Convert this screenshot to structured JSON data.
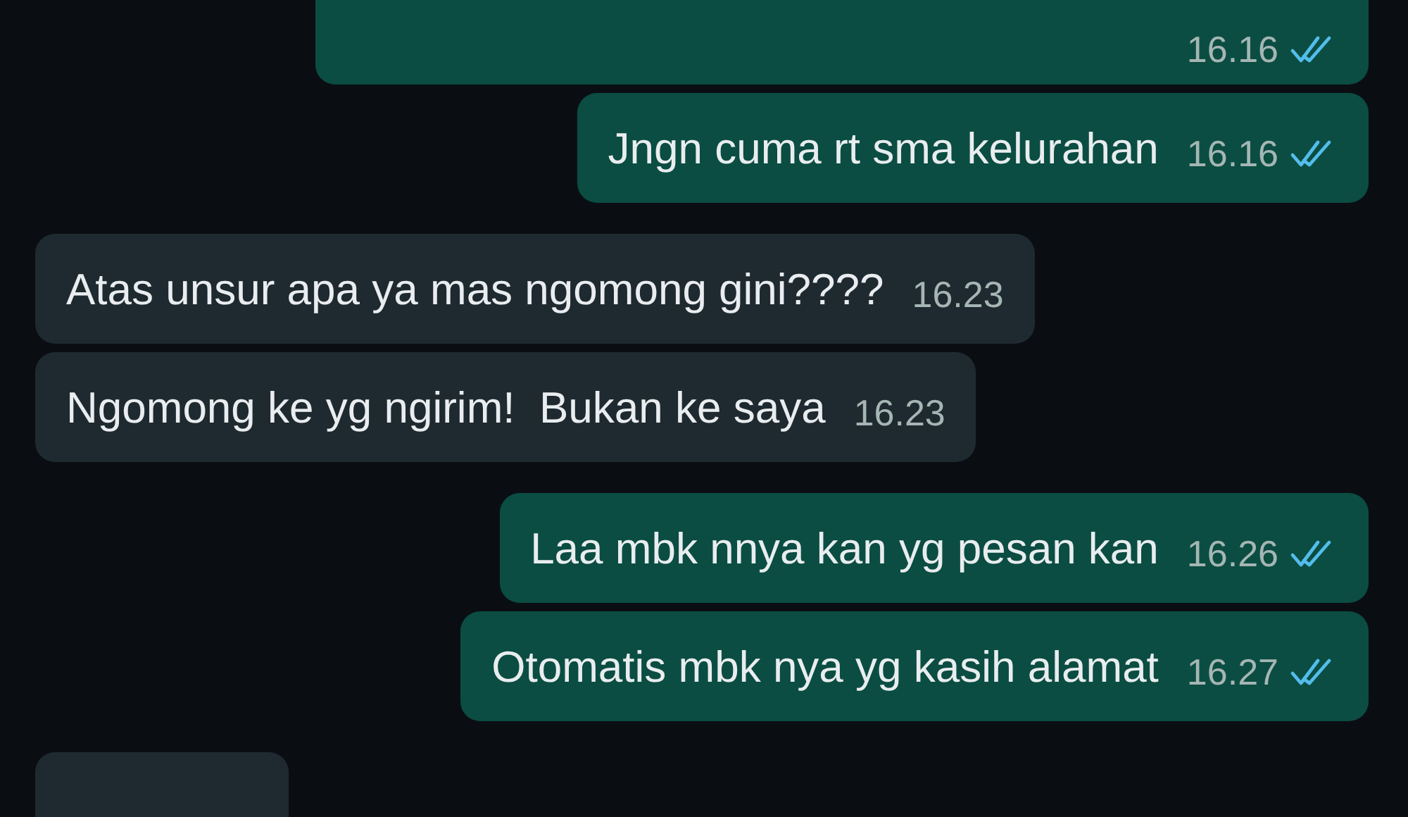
{
  "messages": [
    {
      "kind": "outgoing",
      "time": "16.16",
      "read": true
    },
    {
      "kind": "outgoing",
      "text": "Jngn cuma rt sma kelurahan",
      "time": "16.16",
      "read": true
    },
    {
      "kind": "incoming",
      "text": "Atas unsur apa ya mas ngomong gini????",
      "time": "16.23"
    },
    {
      "kind": "incoming",
      "text": "Ngomong ke yg ngirim!  Bukan ke saya",
      "time": "16.23"
    },
    {
      "kind": "outgoing",
      "text": "Laa mbk nnya kan yg pesan kan",
      "time": "16.26",
      "read": true
    },
    {
      "kind": "outgoing",
      "text": "Otomatis mbk nya yg kasih alamat",
      "time": "16.27",
      "read": true
    },
    {
      "kind": "incoming"
    }
  ]
}
